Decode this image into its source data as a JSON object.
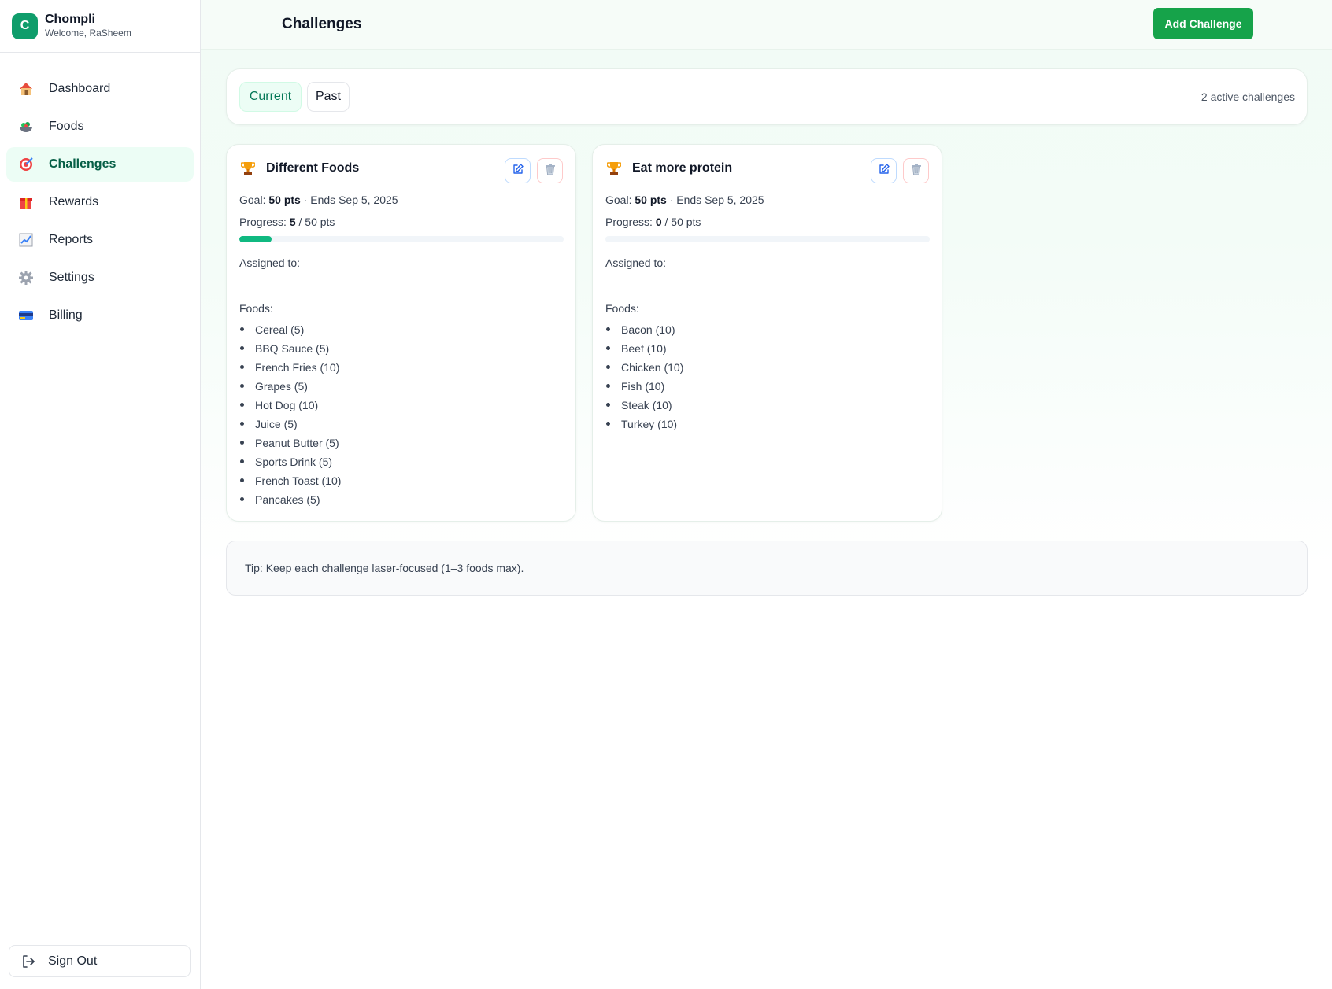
{
  "app": {
    "name": "Chompli",
    "logo_letter": "C",
    "welcome": "Welcome, RaSheem"
  },
  "sidebar": {
    "items": [
      {
        "label": "Dashboard",
        "icon": "house-icon"
      },
      {
        "label": "Foods",
        "icon": "salad-icon"
      },
      {
        "label": "Challenges",
        "icon": "target-icon",
        "active": true
      },
      {
        "label": "Rewards",
        "icon": "gift-icon"
      },
      {
        "label": "Reports",
        "icon": "chart-icon"
      },
      {
        "label": "Settings",
        "icon": "gear-icon"
      },
      {
        "label": "Billing",
        "icon": "credit-card-icon"
      }
    ],
    "sign_out": "Sign Out"
  },
  "header": {
    "title": "Challenges",
    "add_button": "Add Challenge"
  },
  "filters": {
    "current": "Current",
    "past": "Past",
    "active_count": "2 active challenges"
  },
  "challenges": [
    {
      "title": "Different Foods",
      "goal_label": "Goal:",
      "goal_value": "50 pts",
      "ends": "· Ends Sep 5, 2025",
      "progress_label": "Progress:",
      "progress_value": "5",
      "progress_total": "/ 50 pts",
      "progress_fraction": 0.1,
      "assigned_label": "Assigned to:",
      "foods_label": "Foods:",
      "foods": [
        "Cereal (5)",
        "BBQ Sauce (5)",
        "French Fries (10)",
        "Grapes (5)",
        "Hot Dog (10)",
        "Juice (5)",
        "Peanut Butter (5)",
        "Sports Drink (5)",
        "French Toast (10)",
        "Pancakes (5)"
      ]
    },
    {
      "title": "Eat more protein",
      "goal_label": "Goal:",
      "goal_value": "50 pts",
      "ends": "· Ends Sep 5, 2025",
      "progress_label": "Progress:",
      "progress_value": "0",
      "progress_total": "/ 50 pts",
      "progress_fraction": 0,
      "assigned_label": "Assigned to:",
      "foods_label": "Foods:",
      "foods": [
        "Bacon (10)",
        "Beef (10)",
        "Chicken (10)",
        "Fish (10)",
        "Steak (10)",
        "Turkey (10)"
      ]
    }
  ],
  "tip": "Tip: Keep each challenge laser-focused (1–3 foods max).",
  "colors": {
    "brand": "#0f9d6b",
    "accent": "#16a34a",
    "progress": "#10b981",
    "active_nav_bg": "#ecfdf5"
  }
}
